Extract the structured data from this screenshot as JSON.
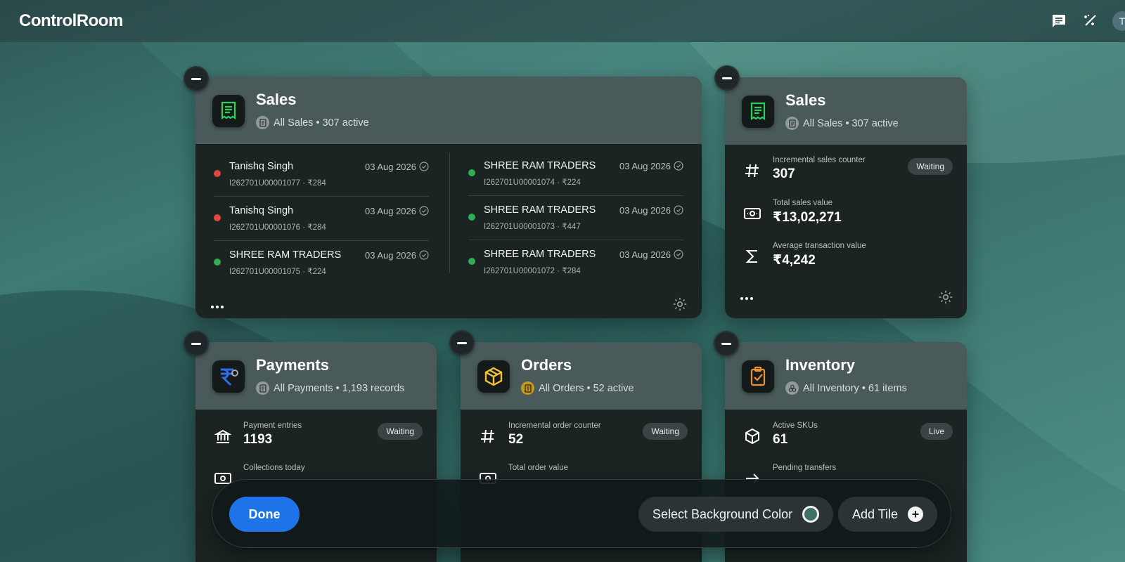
{
  "app": {
    "title": "ControlRoom"
  },
  "header_icons": [
    "chat-icon",
    "magic-icon",
    "avatar"
  ],
  "avatar_initial": "T",
  "tiles": {
    "sales_main": {
      "title": "Sales",
      "subtitle": "All Sales • 307 active",
      "left": [
        {
          "name": "Tanishq Singh",
          "meta": "I262701U00001077 · ₹284",
          "date": "03 Aug 2026",
          "status": "red"
        },
        {
          "name": "Tanishq Singh",
          "meta": "I262701U00001076 · ₹284",
          "date": "03 Aug 2026",
          "status": "red"
        },
        {
          "name": "SHREE RAM TRADERS",
          "meta": "I262701U00001075 · ₹224",
          "date": "03 Aug 2026",
          "status": "green"
        }
      ],
      "right": [
        {
          "name": "SHREE RAM TRADERS",
          "meta": "I262701U00001074 · ₹224",
          "date": "03 Aug 2026",
          "status": "green"
        },
        {
          "name": "SHREE RAM TRADERS",
          "meta": "I262701U00001073 · ₹447",
          "date": "03 Aug 2026",
          "status": "green"
        },
        {
          "name": "SHREE RAM TRADERS",
          "meta": "I262701U00001072 · ₹284",
          "date": "03 Aug 2026",
          "status": "green"
        }
      ]
    },
    "sales_side": {
      "title": "Sales",
      "subtitle": "All Sales • 307 active",
      "badge": "Waiting",
      "metrics": [
        {
          "label": "Incremental sales counter",
          "value": "307",
          "icon": "hash-icon"
        },
        {
          "label": "Total sales value",
          "value": "₹13,02,271",
          "icon": "cash-icon"
        },
        {
          "label": "Average transaction value",
          "value": "₹4,242",
          "icon": "sigma-icon"
        }
      ]
    },
    "payments": {
      "title": "Payments",
      "subtitle": "All Payments • 1,193 records",
      "badge": "Waiting",
      "metrics": [
        {
          "label": "Payment entries",
          "value": "1193",
          "icon": "bank-icon"
        },
        {
          "label": "Collections today",
          "value": "",
          "icon": "cash-icon"
        }
      ]
    },
    "orders": {
      "title": "Orders",
      "subtitle": "All Orders • 52 active",
      "badge": "Waiting",
      "metrics": [
        {
          "label": "Incremental order counter",
          "value": "52",
          "icon": "hash-icon"
        },
        {
          "label": "Total order value",
          "value": "",
          "icon": "cash-icon"
        }
      ]
    },
    "inventory": {
      "title": "Inventory",
      "subtitle": "All Inventory • 61 items",
      "badge": "Live",
      "metrics": [
        {
          "label": "Active SKUs",
          "value": "61",
          "icon": "box-icon"
        },
        {
          "label": "Pending transfers",
          "value": "",
          "icon": "arrow-right-icon"
        }
      ]
    }
  },
  "bottom_bar": {
    "done_label": "Done",
    "bg_color_label": "Select Background Color",
    "add_tile_label": "Add Tile",
    "swatch_color": "#3f6f69"
  },
  "colors": {
    "accent": "#1f73e8",
    "status_red": "#e5453b",
    "status_green": "#2fae55"
  }
}
